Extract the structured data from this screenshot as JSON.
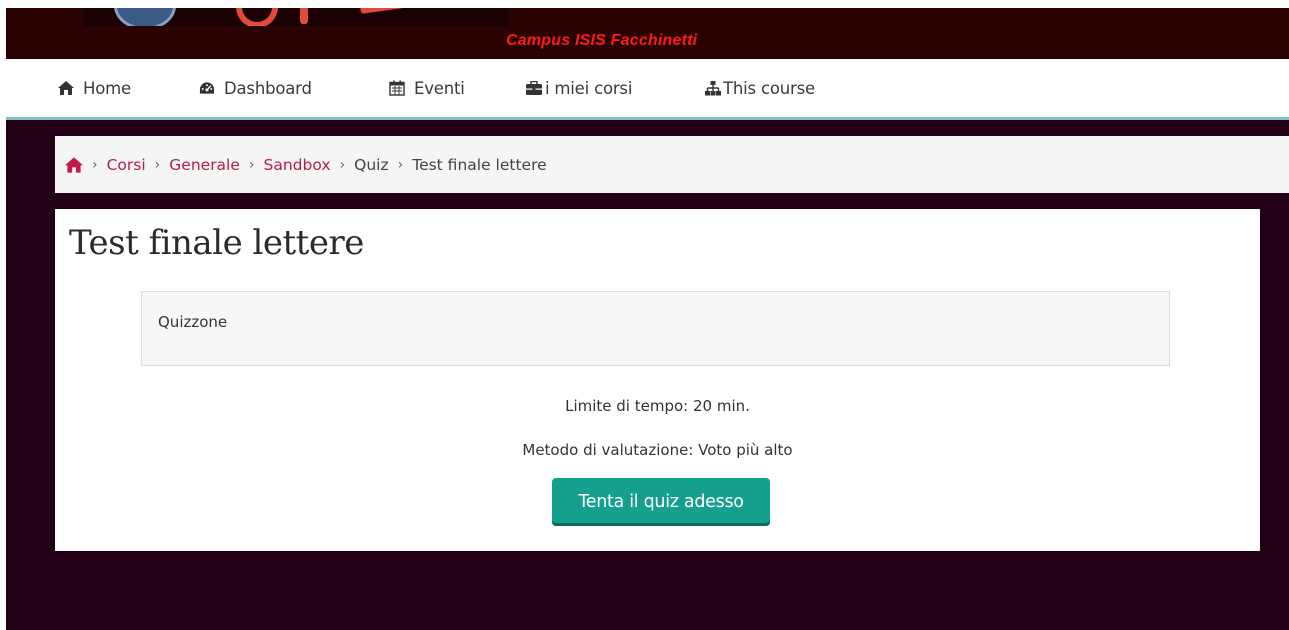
{
  "header": {
    "site_name": "Campus ISIS Facchinetti"
  },
  "navbar": {
    "items": [
      {
        "label": "Home",
        "icon": "home-icon"
      },
      {
        "label": "Dashboard",
        "icon": "dashboard-icon"
      },
      {
        "label": "Eventi",
        "icon": "calendar-icon"
      },
      {
        "label": "i miei corsi",
        "icon": "briefcase-icon"
      },
      {
        "label": "This course",
        "icon": "sitemap-icon"
      }
    ]
  },
  "breadcrumb": {
    "items": [
      {
        "label": "Corsi",
        "link": true
      },
      {
        "label": "Generale",
        "link": true
      },
      {
        "label": "Sandbox",
        "link": true
      },
      {
        "label": "Quiz",
        "link": false
      },
      {
        "label": "Test finale lettere",
        "link": false
      }
    ],
    "separator": "›"
  },
  "quiz": {
    "title": "Test finale lettere",
    "intro": "Quizzone",
    "time_limit": "Limite di tempo: 20 min.",
    "grading_method": "Metodo di valutazione: Voto più alto",
    "start_button": "Tenta il quiz adesso"
  },
  "colors": {
    "banner_bg": "#2a0202",
    "site_name": "#ff1a1a",
    "main_bg": "#220016",
    "link": "#b22146",
    "button": "#14a08c",
    "nav_border": "#7dc1c3"
  }
}
